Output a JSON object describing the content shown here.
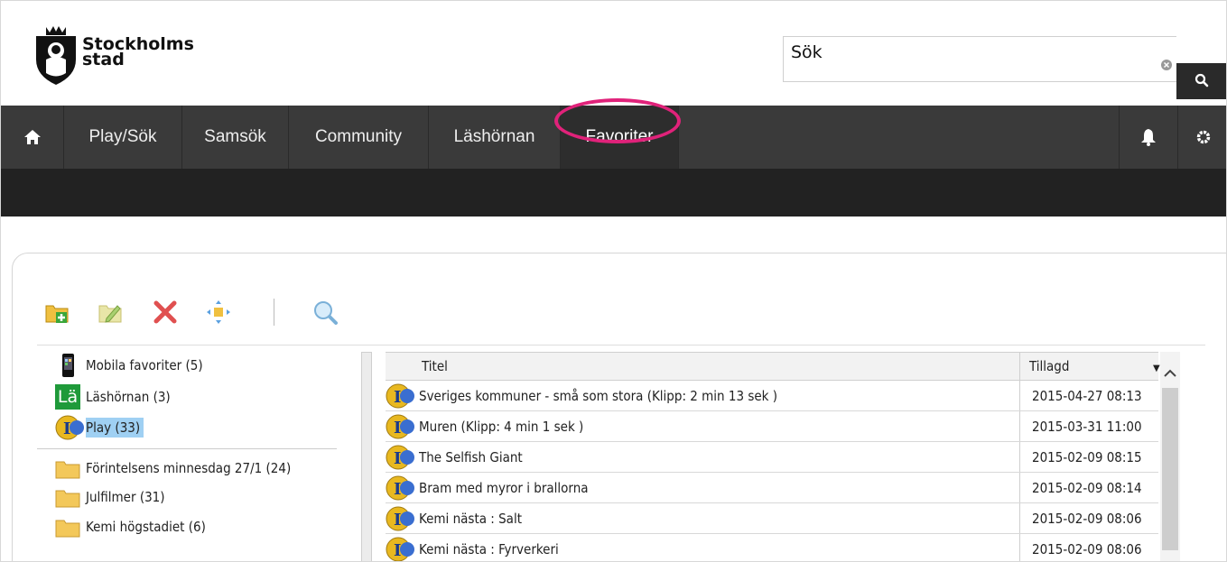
{
  "header": {
    "brand_line1": "Stockholms",
    "brand_line2": "stad",
    "search_placeholder": "Sök"
  },
  "nav": {
    "items": [
      {
        "label": "Play/Sök"
      },
      {
        "label": "Samsök"
      },
      {
        "label": "Community"
      },
      {
        "label": "Läshörnan"
      },
      {
        "label": "Favoriter"
      }
    ]
  },
  "tree": {
    "items": [
      {
        "label": "Mobila favoriter (5)",
        "icon": "phone-icon"
      },
      {
        "label": "Läshörnan (3)",
        "icon": "lashornan-icon"
      },
      {
        "label": "Play (33)",
        "icon": "play-icon"
      },
      {
        "label": "Förintelsens minnesdag 27/1 (24)",
        "icon": "folder-icon"
      },
      {
        "label": "Julfilmer (31)",
        "icon": "folder-icon"
      },
      {
        "label": "Kemi högstadiet (6)",
        "icon": "folder-icon"
      }
    ],
    "lashornan_badge": "Lä"
  },
  "table": {
    "headers": {
      "title": "Titel",
      "added": "Tillagd"
    },
    "rows": [
      {
        "title": "Sveriges kommuner - små som stora (Klipp: 2 min 13 sek )",
        "added": "2015-04-27 08:13"
      },
      {
        "title": "Muren (Klipp: 4 min 1 sek )",
        "added": "2015-03-31 11:00"
      },
      {
        "title": "The Selfish Giant",
        "added": "2015-02-09 08:15"
      },
      {
        "title": "Bram med myror i brallorna",
        "added": "2015-02-09 08:14"
      },
      {
        "title": "Kemi nästa : Salt",
        "added": "2015-02-09 08:06"
      },
      {
        "title": "Kemi nästa : Fyrverkeri",
        "added": "2015-02-09 08:06"
      }
    ]
  },
  "colors": {
    "nav_bg": "#3a3a3a",
    "highlight": "#e0227a",
    "selected": "#9fd0f3"
  }
}
